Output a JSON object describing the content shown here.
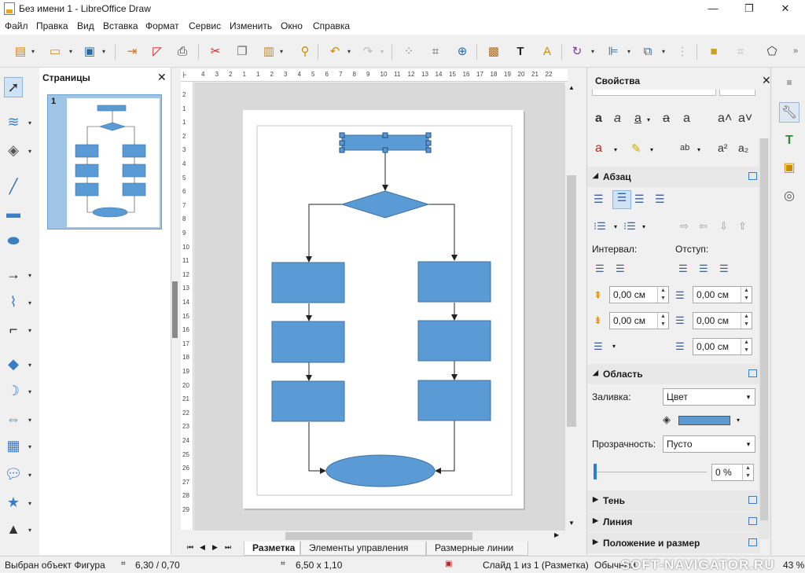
{
  "window": {
    "title": "Без имени 1 - LibreOffice Draw",
    "minimize": "—",
    "maximize": "❐",
    "close": "✕"
  },
  "menu": [
    "Файл",
    "Правка",
    "Вид",
    "Вставка",
    "Формат",
    "Сервис",
    "Изменить",
    "Окно",
    "Справка"
  ],
  "pages_panel": {
    "title": "Страницы",
    "close": "✕",
    "page_number": "1"
  },
  "hruler": {
    "ticks": [
      "4",
      "3",
      "2",
      "1",
      "1",
      "2",
      "3",
      "4",
      "5",
      "6",
      "7",
      "8",
      "9",
      "10",
      "11",
      "12",
      "13",
      "14",
      "15",
      "16",
      "17",
      "18",
      "19",
      "20",
      "21",
      "22"
    ]
  },
  "vruler": {
    "ticks": [
      "2",
      "1",
      "1",
      "2",
      "3",
      "4",
      "5",
      "6",
      "7",
      "8",
      "9",
      "10",
      "11",
      "12",
      "13",
      "14",
      "15",
      "16",
      "17",
      "18",
      "19",
      "20",
      "21",
      "22",
      "23",
      "24",
      "25",
      "26",
      "27",
      "28",
      "29"
    ]
  },
  "tabs": [
    "Разметка",
    "Элементы управления",
    "Размерные линии"
  ],
  "status": {
    "selection": "Выбран объект Фигура",
    "position": "6,30 / 0,70",
    "size": "6,50 x 1,10",
    "slide": "Слайд 1 из 1 (Разметка)",
    "style": "Обычный",
    "zoom": "43 %",
    "watermark": "SOFT-NAVIGATOR.RU"
  },
  "sidebar": {
    "title": "Свойства",
    "close": "✕",
    "paragraph": {
      "header": "Абзац",
      "interval_label": "Интервал:",
      "indent_label": "Отступ:",
      "spacing_above": "0,00 см",
      "spacing_below": "0,00 см",
      "indent_before": "0,00 см",
      "indent_after": "0,00 см",
      "indent_first": "0,00 см"
    },
    "area": {
      "header": "Область",
      "fill_label": "Заливка:",
      "fill_value": "Цвет",
      "fill_color": "#5b9bd5",
      "transparency_label": "Прозрачность:",
      "transparency_value": "Пусто",
      "transparency_pct": "0 %"
    },
    "shadow": {
      "header": "Тень"
    },
    "line": {
      "header": "Линия"
    },
    "position": {
      "header": "Положение и размер"
    }
  },
  "colors": {
    "shape_fill": "#5b9bd5",
    "shape_border": "#41719c",
    "accent": "#3a7fc4"
  }
}
